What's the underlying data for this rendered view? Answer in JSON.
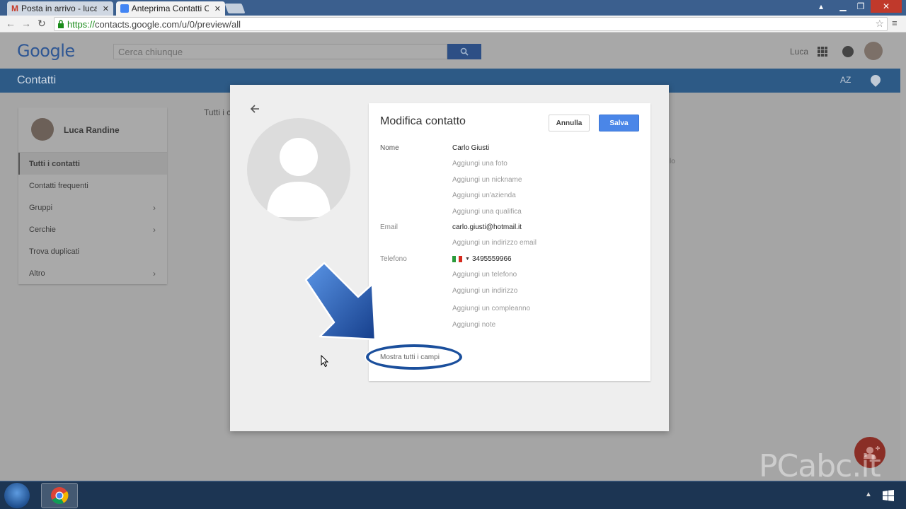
{
  "browser": {
    "tabs": [
      {
        "title": "Posta in arrivo - luca",
        "icon": "gmail-icon"
      },
      {
        "title": "Anteprima Contatti C",
        "icon": "contacts-icon"
      }
    ],
    "url_scheme": "https://",
    "url_rest": "contacts.google.com/u/0/preview/all"
  },
  "app": {
    "logo": "Google",
    "search_placeholder": "Cerca chiunque",
    "user": "Luca",
    "section_title": "Contatti",
    "sort_label": "AZ"
  },
  "sidebar": {
    "user_name": "Luca Randine",
    "items": [
      {
        "label": "Tutti i contatti",
        "active": true,
        "chevron": false
      },
      {
        "label": "Contatti frequenti",
        "active": false,
        "chevron": false
      },
      {
        "label": "Gruppi",
        "active": false,
        "chevron": true
      },
      {
        "label": "Cerchie",
        "active": false,
        "chevron": true
      },
      {
        "label": "Trova duplicati",
        "active": false,
        "chevron": false
      },
      {
        "label": "Altro",
        "active": false,
        "chevron": true
      }
    ]
  },
  "page": {
    "crumb_fragment": "Tutti i c",
    "right_fragment": "lo"
  },
  "dialog": {
    "title": "Modifica contatto",
    "cancel": "Annulla",
    "save": "Salva",
    "labels": {
      "name": "Nome",
      "email": "Email",
      "phone": "Telefono"
    },
    "name_value": "Carlo Giusti",
    "add_photo": "Aggiungi una foto",
    "add_nickname": "Aggiungi un nickname",
    "add_company": "Aggiungi un'azienda",
    "add_title": "Aggiungi una qualifica",
    "email_value": "carlo.giusti@hotmail.it",
    "add_email": "Aggiungi un indirizzo email",
    "phone_value": "3495559966",
    "add_phone": "Aggiungi un telefono",
    "add_address": "Aggiungi un indirizzo",
    "add_birthday": "Aggiungi un compleanno",
    "add_notes": "Aggiungi note",
    "show_all": "Mostra tutti i campi"
  },
  "watermark": "PCabc.it",
  "colors": {
    "accent_blue": "#4a86e8",
    "header_bar": "#2d5a86",
    "annotation_blue": "#1b4f9c"
  }
}
